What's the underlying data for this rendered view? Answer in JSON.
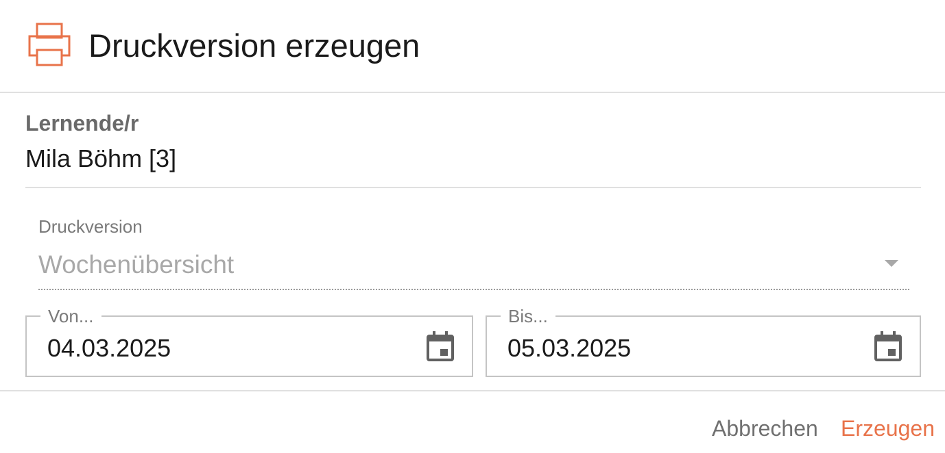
{
  "dialog": {
    "title": "Druckversion erzeugen",
    "icon": "printer-icon"
  },
  "learner": {
    "label": "Lernende/r",
    "value": "Mila Böhm [3]"
  },
  "print_version": {
    "label": "Druckversion",
    "value": "Wochenübersicht",
    "icon": "chevron-down-icon"
  },
  "date_from": {
    "label": "Von...",
    "value": "04.03.2025",
    "icon": "calendar-icon"
  },
  "date_to": {
    "label": "Bis...",
    "value": "05.03.2025",
    "icon": "calendar-icon"
  },
  "actions": {
    "cancel_label": "Abbrechen",
    "create_label": "Erzeugen"
  },
  "colors": {
    "accent": "#e8734a",
    "title_text": "#1a1a1a",
    "muted_text": "#7a7a7a",
    "divider": "#e0e0e0",
    "icon_gray": "#616161"
  }
}
